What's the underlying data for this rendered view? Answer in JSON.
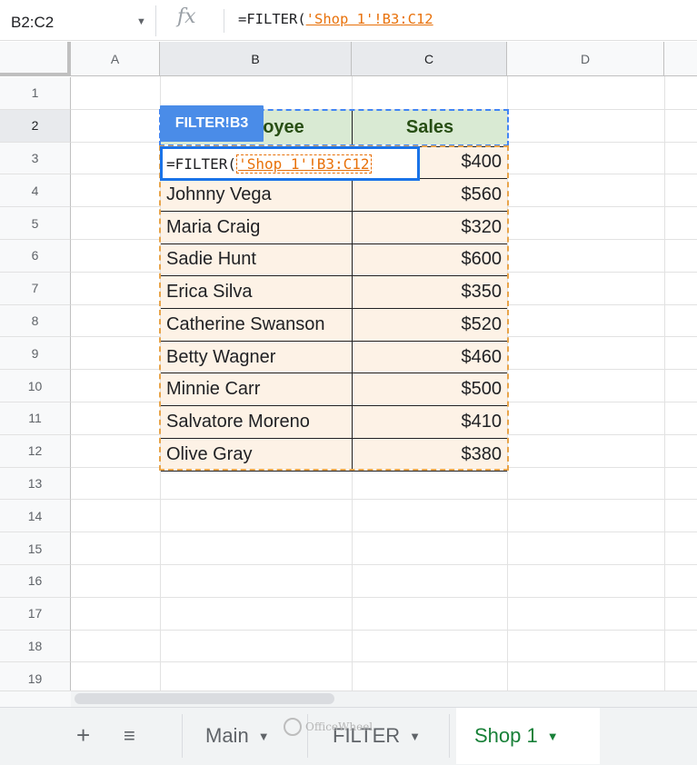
{
  "name_box": {
    "value": "B2:C2"
  },
  "formula_bar": {
    "fx_label": "fx",
    "formula_prefix": "=FILTER(",
    "formula_ref": "'Shop 1'!B3:C12"
  },
  "columns": [
    "A",
    "B",
    "C",
    "D"
  ],
  "rows": [
    "1",
    "2",
    "3",
    "4",
    "5",
    "6",
    "7",
    "8",
    "9",
    "10",
    "11",
    "12",
    "13",
    "14",
    "15",
    "16",
    "17",
    "18",
    "19"
  ],
  "table": {
    "headers": {
      "name": "Employee",
      "name_visible": "oyee",
      "sales": "Sales"
    },
    "rows": [
      {
        "name": "",
        "sales": "$400"
      },
      {
        "name": "Johnny Vega",
        "sales": "$560"
      },
      {
        "name": "Maria Craig",
        "sales": "$320"
      },
      {
        "name": "Sadie Hunt",
        "sales": "$600"
      },
      {
        "name": "Erica Silva",
        "sales": "$350"
      },
      {
        "name": "Catherine Swanson",
        "sales": "$520"
      },
      {
        "name": "Betty Wagner",
        "sales": "$460"
      },
      {
        "name": "Minnie Carr",
        "sales": "$500"
      },
      {
        "name": "Salvatore Moreno",
        "sales": "$410"
      },
      {
        "name": "Olive Gray",
        "sales": "$380"
      }
    ]
  },
  "range_chip": "FILTER!B3",
  "cell_editor": {
    "prefix": "=FILTER(",
    "ref": "'Shop 1'!B3:C12"
  },
  "sheet_tabs": [
    {
      "label": "Main",
      "active": false
    },
    {
      "label": "FILTER",
      "active": false
    },
    {
      "label": "Shop 1",
      "active": true
    }
  ],
  "tab_controls": {
    "add": "+",
    "list": "≡"
  },
  "watermark": "OfficeWheel",
  "colors": {
    "header_green": "#d9ead3",
    "body_cream": "#fdf2e6",
    "active_tab": "#188038",
    "selection_blue": "#1a73e8",
    "ref_orange": "#e8710a"
  }
}
